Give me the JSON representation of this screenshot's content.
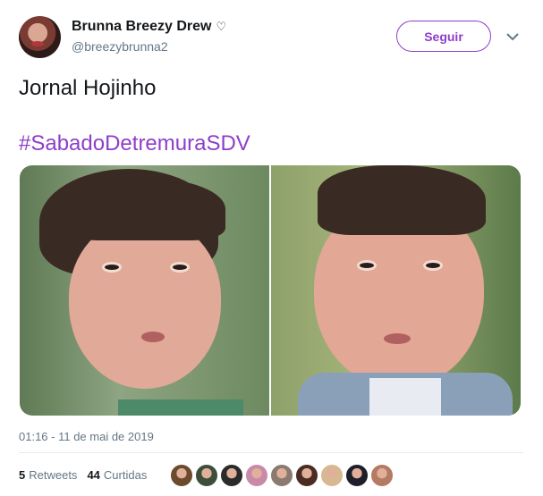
{
  "user": {
    "display_name": "Brunna Breezy Drew",
    "badge_symbol": "♡",
    "handle": "@breezybrunna2"
  },
  "actions": {
    "follow_label": "Seguir",
    "menu_caret": "⌄"
  },
  "tweet": {
    "text": "Jornal Hojinho",
    "hashtag": "#SabadoDetremuraSDV",
    "timestamp": "01:16 - 11 de mai de 2019"
  },
  "stats": {
    "retweets_count": "5",
    "retweets_label": "Retweets",
    "likes_count": "44",
    "likes_label": "Curtidas"
  },
  "likers": [
    {
      "color": "#6b4a2e"
    },
    {
      "color": "#3d4f3a"
    },
    {
      "color": "#2b2b2b"
    },
    {
      "color": "#c88aa8"
    },
    {
      "color": "#8a7a70"
    },
    {
      "color": "#4a2c22"
    },
    {
      "color": "#d8b890"
    },
    {
      "color": "#1f1f2a"
    },
    {
      "color": "#b47a62"
    }
  ],
  "colors": {
    "accent": "#8e3ec9",
    "muted": "#657786",
    "text": "#14171a"
  }
}
